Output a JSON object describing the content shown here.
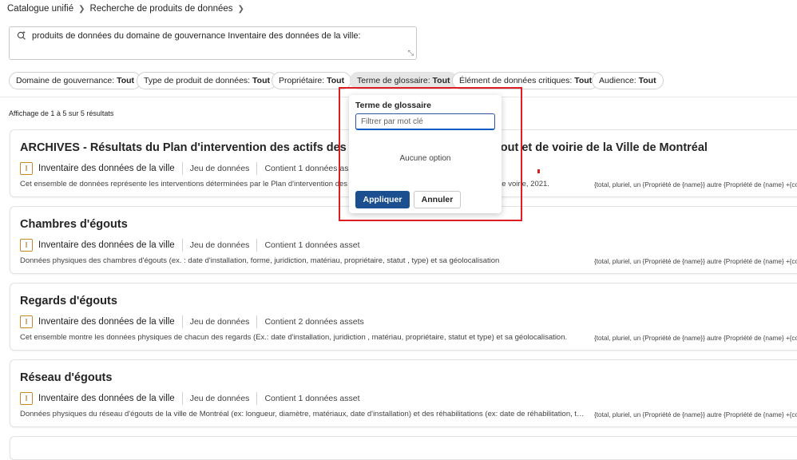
{
  "breadcrumb": [
    "Catalogue unifié",
    "Recherche de produits de données"
  ],
  "search": {
    "query": "produits de données du domaine de gouvernance Inventaire des données de la ville:"
  },
  "filters": [
    {
      "label": "Domaine de gouvernance:",
      "value": "Tout"
    },
    {
      "label": "Type de produit de données:",
      "value": "Tout"
    },
    {
      "label": "Propriétaire:",
      "value": "Tout"
    },
    {
      "label": "Terme de glossaire:",
      "value": "Tout",
      "active": true
    },
    {
      "label": "Élément de données critiques:",
      "value": "Tout"
    },
    {
      "label": "Audience:",
      "value": "Tout"
    }
  ],
  "results_count": "Affichage de 1 à 5 sur 5 résultats",
  "results": [
    {
      "title": "ARCHIVES - Résultats du Plan d'intervention des actifs des réseaux d'eau potable, d'égout et de voirie de la Ville de Montréal",
      "badge": "I",
      "domain": "Inventaire des données de la ville",
      "type": "Jeu de données",
      "assets": "Contient 1 données asset",
      "description": "Cet ensemble de données représente les interventions déterminées par le Plan d'intervention des actifs des réseaux d'eau potable, d'égout et de voirie, 2021.",
      "plural": "{total, pluriel, un {Propriété de {name}} autre {Propriété de {name} +{count}}}"
    },
    {
      "title": "Chambres d'égouts",
      "badge": "I",
      "domain": "Inventaire des données de la ville",
      "type": "Jeu de données",
      "assets": "Contient 1 données asset",
      "description": "Données physiques des chambres d'égouts (ex. : date d'installation, forme, juridiction, matériau, propriétaire, statut , type) et sa géolocalisation",
      "plural": "{total, pluriel, un {Propriété de {name}} autre {Propriété de {name} +{count}}}"
    },
    {
      "title": "Regards d'égouts",
      "badge": "I",
      "domain": "Inventaire des données de la ville",
      "type": "Jeu de données",
      "assets": "Contient 2 données assets",
      "description": "Cet ensemble montre les données physiques de chacun des regards (Ex.: date d'installation, juridiction , matériau, propriétaire, statut et type) et sa géolocalisation.",
      "plural": "{total, pluriel, un {Propriété de {name}} autre {Propriété de {name} +{count}}}"
    },
    {
      "title": "Réseau d'égouts",
      "badge": "I",
      "domain": "Inventaire des données de la ville",
      "type": "Jeu de données",
      "assets": "Contient 1 données asset",
      "description": "Données physiques du réseau d'égouts de la ville de Montréal (ex: longueur, diamètre, matériaux, date d'installation)  et des réhabilitations (ex: date de réhabilitation, type de réhabilitation, matériau)",
      "plural": "{total, pluriel, un {Propriété de {name}} autre {Propriété de {name} +{count}}}"
    }
  ],
  "dropdown": {
    "title": "Terme de glossaire",
    "placeholder": "Filtrer par mot clé",
    "empty": "Aucune option",
    "apply": "Appliquer",
    "cancel": "Annuler"
  },
  "colors": {
    "primary_button": "#1b4f8f",
    "highlight": "#e11d24",
    "badge_border": "#c8862c"
  }
}
